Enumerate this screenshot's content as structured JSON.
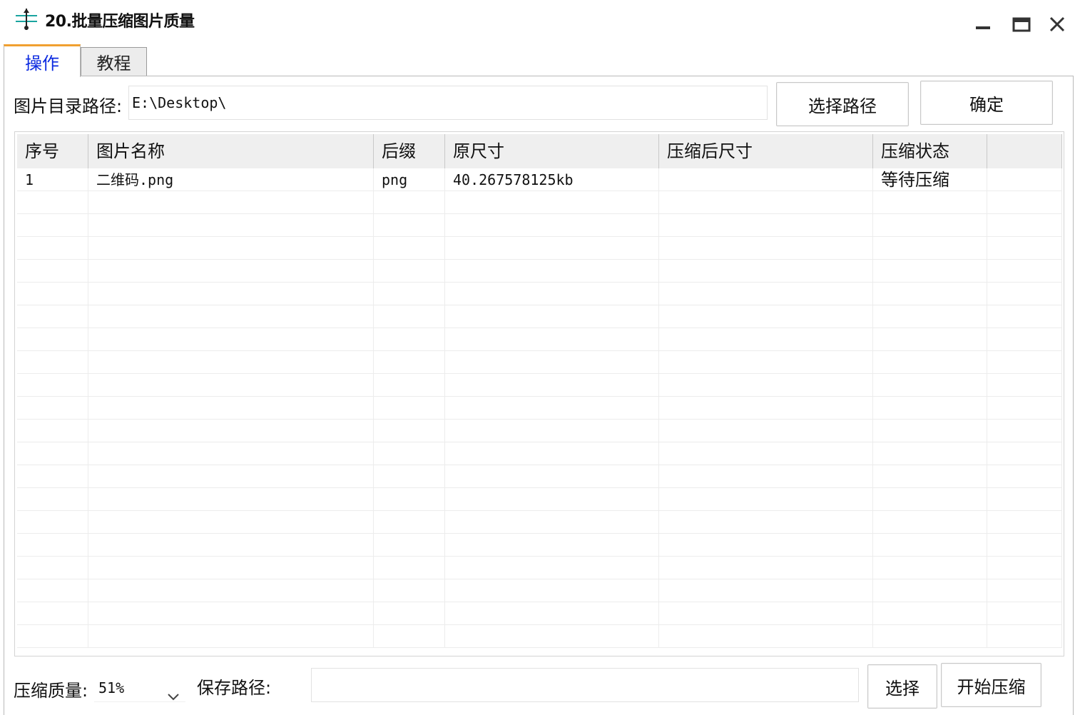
{
  "window": {
    "title": "20.批量压缩图片质量",
    "icon": "app-icon",
    "controls": [
      "minimize-icon",
      "maximize-icon",
      "close-icon"
    ]
  },
  "tabs": [
    {
      "label": "操作",
      "active": true
    },
    {
      "label": "教程",
      "active": false
    }
  ],
  "colors": {
    "active_tab_text": "#0b2ae0",
    "active_tab_accent": "#f0a030",
    "header_bg": "#efefef"
  },
  "toolbar": {
    "dir_label": "图片目录路径:",
    "dir_value": "E:\\Desktop\\",
    "choose_path_button": "选择路径",
    "confirm_button": "确定"
  },
  "table": {
    "columns": [
      "序号",
      "图片名称",
      "后缀",
      "原尺寸",
      "压缩后尺寸",
      "压缩状态",
      ""
    ],
    "rows": [
      [
        "1",
        "二维码.png",
        "png",
        "40.267578125kb",
        "",
        "等待压缩",
        ""
      ]
    ]
  },
  "bottom": {
    "quality_label": "压缩质量:",
    "quality_value": "51%",
    "save_label": "保存路径:",
    "save_value": "",
    "select_button": "选择",
    "start_button": "开始压缩"
  }
}
